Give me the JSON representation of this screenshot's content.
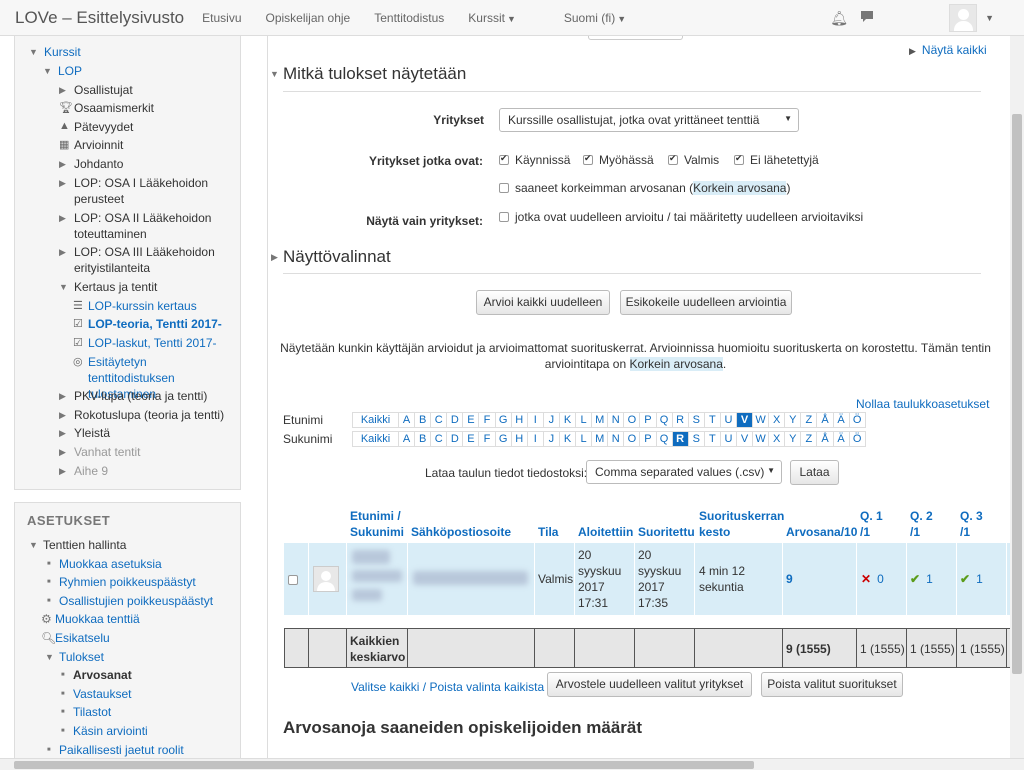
{
  "nav": {
    "brand": "LOVe – Esittelysivusto",
    "items": [
      "Etusivu",
      "Opiskelijan ohje",
      "Tenttitodistus",
      "Kurssit",
      "Suomi (fi)"
    ]
  },
  "sidebar": {
    "items": [
      {
        "label": "Kurssit",
        "level": 0,
        "open": true
      },
      {
        "label": "LOP",
        "level": 1,
        "open": true
      },
      {
        "label": "Osallistujat",
        "level": 2,
        "type": "branch"
      },
      {
        "label": "Osaamismerkit",
        "level": 2,
        "type": "trophy"
      },
      {
        "label": "Pätevyydet",
        "level": 2,
        "type": "pyramid"
      },
      {
        "label": "Arvioinnit",
        "level": 2,
        "type": "table"
      },
      {
        "label": "Johdanto",
        "level": 2,
        "type": "branch"
      },
      {
        "label": "LOP: OSA I Lääkehoidon perusteet",
        "level": 2,
        "type": "branch"
      },
      {
        "label": "LOP: OSA II Lääkehoidon toteuttaminen",
        "level": 2,
        "type": "branch"
      },
      {
        "label": "LOP: OSA III Lääkehoidon erityistilanteita",
        "level": 2,
        "type": "branch"
      },
      {
        "label": "Kertaus ja tentit",
        "level": 2,
        "open": true
      },
      {
        "label": "LOP-kurssin kertaus",
        "level": 3,
        "type": "lesson"
      },
      {
        "label": "LOP-teoria, Tentti 2017-",
        "level": 3,
        "type": "quiz"
      },
      {
        "label": "LOP-laskut, Tentti 2017-",
        "level": 3,
        "type": "quiz"
      },
      {
        "label": "Esitäytetyn tenttitodistuksen tulostaminen",
        "level": 3,
        "type": "cert"
      },
      {
        "label": "PKV-lupa (teoria ja tentti)",
        "level": 2,
        "type": "branch"
      },
      {
        "label": "Rokotuslupa (teoria ja tentti)",
        "level": 2,
        "type": "branch"
      },
      {
        "label": "Yleistä",
        "level": 2,
        "type": "branch"
      },
      {
        "label": "Vanhat tentit",
        "level": 2,
        "type": "branch"
      },
      {
        "label": "Aihe 9",
        "level": 2,
        "type": "branch"
      }
    ]
  },
  "settings": {
    "title": "ASETUKSET",
    "items": [
      "Tenttien hallinta",
      "Muokkaa asetuksia",
      "Ryhmien poikkeuspäästyt",
      "Osallistujien poikkeuspäästyt",
      "Muokkaa tenttiä",
      "Esikatselu",
      "Tulokset",
      "Arvosanat",
      "Vastaukset",
      "Tilastot",
      "Käsin arviointi",
      "Paikallisesti jaetut roolit"
    ]
  },
  "main": {
    "show_all": "Näytä kaikki",
    "section1": "Mitkä tulokset näytetään",
    "attempts_label": "Yritykset",
    "attempts_value": "Kurssille osallistujat, jotka ovat yrittäneet tenttiä",
    "states_label": "Yritykset jotka ovat:",
    "states": [
      "Käynnissä",
      "Myöhässä",
      "Valmis",
      "Ei lähetettyjä"
    ],
    "highest": "saaneet korkeimman arvosanan (",
    "highest_link": "Korkein arvosana",
    "highest_end": ")",
    "only_label": "Näytä vain yritykset:",
    "only_text": "jotka ovat uudelleen arvioitu / tai määritetty uudelleen arvioitaviksi",
    "section2": "Näyttövalinnat",
    "btn_regrade": "Arvioi kaikki uudelleen",
    "btn_dryrun": "Esikokeile uudelleen arviointia",
    "info1": "Näytetään kunkin käyttäjän arvioidut ja arvioimattomat suorituskerrat. Arvioinnissa huomioitu suorituskerta on korostettu. Tämän tentin",
    "info2": "arviointitapa on ",
    "info2_link": "Korkein arvosana",
    "info2_end": ".",
    "reset": "Nollaa taulukkoasetukset",
    "firstname": "Etunimi",
    "lastname": "Sukunimi",
    "initials_all": "Kaikki",
    "letters": [
      "A",
      "B",
      "C",
      "D",
      "E",
      "F",
      "G",
      "H",
      "I",
      "J",
      "K",
      "L",
      "M",
      "N",
      "O",
      "P",
      "Q",
      "R",
      "S",
      "T",
      "U",
      "V",
      "W",
      "X",
      "Y",
      "Z",
      "Å",
      "Ä",
      "Ö"
    ],
    "first_sel": "V",
    "last_sel": "R",
    "download_label": "Lataa taulun tiedot tiedostoksi:",
    "download_format": "Comma separated values (.csv)",
    "download_btn": "Lataa",
    "headers": {
      "name1": "Etunimi /",
      "name2": "Sukunimi",
      "email": "Sähköpostiosoite",
      "state": "Tila",
      "started": "Aloitettiin",
      "finished": "Suoritettu",
      "duration1": "Suorituskerran",
      "duration2": "kesto",
      "grade": "Arvosana/10",
      "q1a": "Q. 1",
      "q1b": "/1",
      "q2a": "Q. 2",
      "q2b": "/1",
      "q3a": "Q. 3",
      "q3b": "/1"
    },
    "row": {
      "state": "Valmis",
      "started": [
        "20",
        "syyskuu",
        "2017",
        "17:31"
      ],
      "finished": [
        "20",
        "syyskuu",
        "2017",
        "17:35"
      ],
      "duration": [
        "4 min 12",
        "sekuntia"
      ],
      "grade": "9",
      "q1": "0",
      "q2": "1",
      "q3": "1"
    },
    "avg": {
      "label1": "Kaikkien",
      "label2": "keskiarvo",
      "grade": "9 (1555)",
      "q1": "1 (1555)",
      "q2": "1 (1555)",
      "q3": "1 (1555)"
    },
    "select_all": "Valitse kaikki / Poista valinta kaikista",
    "btn_regrade_sel": "Arvostele uudelleen valitut yritykset",
    "btn_delete": "Poista valitut suoritukset",
    "heading3": "Arvosanoja saaneiden opiskelijoiden määrät"
  }
}
